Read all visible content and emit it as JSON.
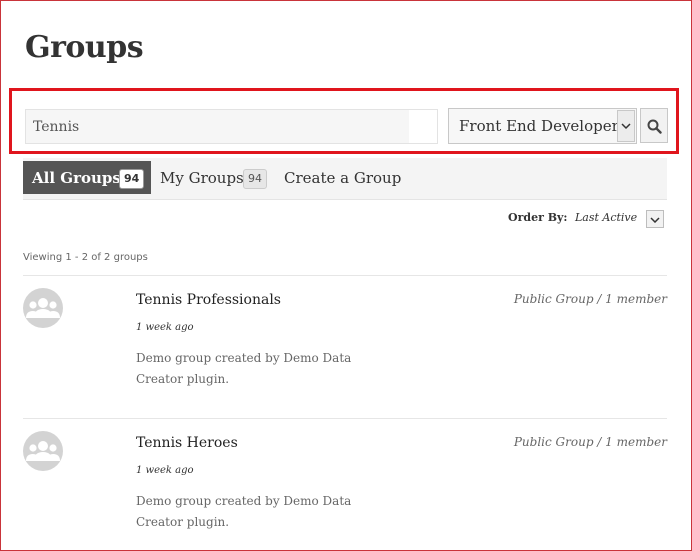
{
  "page": {
    "title": "Groups"
  },
  "search": {
    "value": "Tennis",
    "placeholder": ""
  },
  "filter": {
    "selected": "Front End Developer"
  },
  "tabs": [
    {
      "label": "All Groups",
      "count": "94"
    },
    {
      "label": "My Groups",
      "count": "94"
    },
    {
      "label": "Create a Group"
    }
  ],
  "order": {
    "label": "Order By:",
    "value": "Last Active"
  },
  "viewing": "Viewing 1 - 2 of 2 groups",
  "groups": [
    {
      "name": "Tennis Professionals",
      "meta": "Public Group / 1 member",
      "time": "1 week ago",
      "desc": "Demo group created by Demo Data Creator plugin."
    },
    {
      "name": "Tennis Heroes",
      "meta": "Public Group / 1 member",
      "time": "1 week ago",
      "desc": "Demo group created by Demo Data Creator plugin."
    }
  ],
  "colors": {
    "highlight": "#e0151d",
    "activeTab": "#555555",
    "frame": "#c9343a"
  }
}
